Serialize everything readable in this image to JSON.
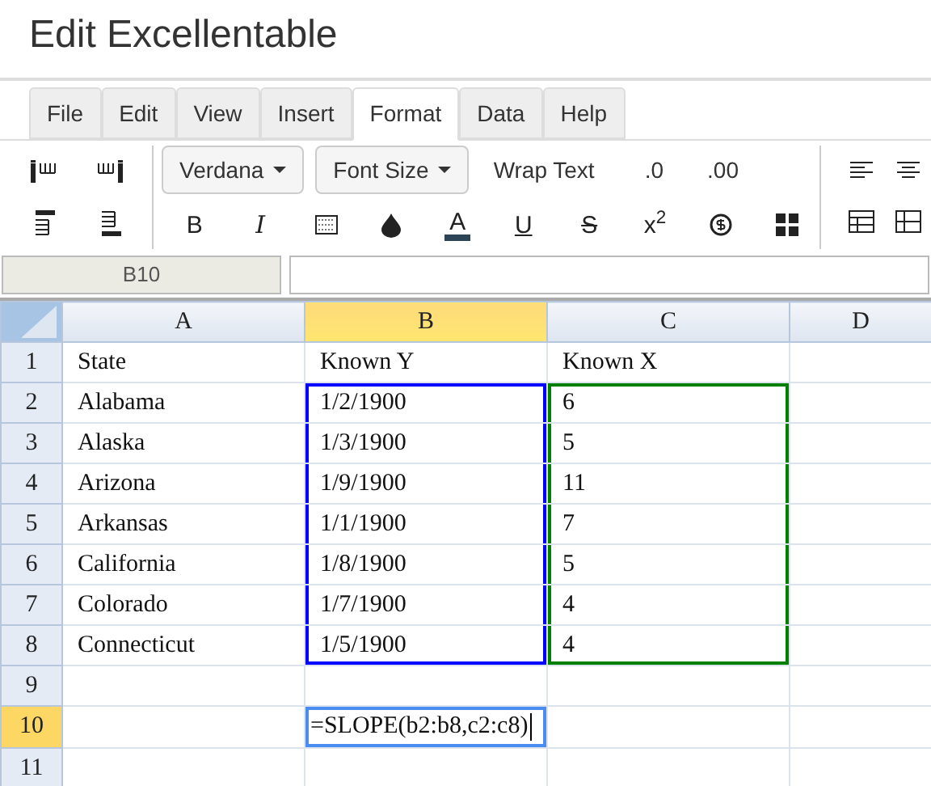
{
  "window": {
    "title": "Edit Excellentable"
  },
  "menu_tabs": [
    {
      "label": "File",
      "selected": false
    },
    {
      "label": "Edit",
      "selected": false
    },
    {
      "label": "View",
      "selected": false
    },
    {
      "label": "Insert",
      "selected": false
    },
    {
      "label": "Format",
      "selected": true
    },
    {
      "label": "Data",
      "selected": false
    },
    {
      "label": "Help",
      "selected": false
    }
  ],
  "toolbar": {
    "font_dropdown": "Verdana",
    "size_dropdown": "Font Size",
    "text_buttons": [
      "Wrap Text",
      ".0",
      ".00"
    ],
    "format_buttons": [
      {
        "kind": "bold",
        "label": "B"
      },
      {
        "kind": "italic",
        "label": "I"
      },
      {
        "kind": "border"
      },
      {
        "kind": "fill"
      },
      {
        "kind": "color",
        "label": "A"
      },
      {
        "kind": "underline",
        "label": "U"
      },
      {
        "kind": "strike",
        "label": "S"
      },
      {
        "kind": "super",
        "label": "x$^{2}$"
      },
      {
        "kind": "currency"
      },
      {
        "kind": "grid"
      }
    ]
  },
  "name_box": "B10",
  "grid": {
    "columns": [
      {
        "label": "A",
        "selected": false
      },
      {
        "label": "B",
        "selected": true
      },
      {
        "label": "C",
        "selected": false
      },
      {
        "label": "D",
        "selected": false
      }
    ],
    "rows": [
      {
        "label": "1",
        "selected": false,
        "cells": [
          {
            "text": "State"
          },
          {
            "text": "Known Y"
          },
          {
            "text": "Known X"
          },
          {}
        ]
      },
      {
        "label": "2",
        "selected": false,
        "cells": [
          {
            "text": "Alabama"
          },
          {
            "text": "1/2/1900",
            "color": "#0000ff"
          },
          {
            "text": "6",
            "color": "#008000"
          },
          {}
        ]
      },
      {
        "label": "3",
        "selected": false,
        "cells": [
          {
            "text": "Alaska"
          },
          {
            "text": "1/3/1900",
            "color": "#0000ff"
          },
          {
            "text": "5",
            "color": "#008000"
          },
          {}
        ]
      },
      {
        "label": "4",
        "selected": false,
        "cells": [
          {
            "text": "Arizona"
          },
          {
            "text": "1/9/1900",
            "color": "#0000ff"
          },
          {
            "text": "11",
            "color": "#008000"
          },
          {}
        ]
      },
      {
        "label": "5",
        "selected": false,
        "cells": [
          {
            "text": "Arkansas"
          },
          {
            "text": "1/1/1900",
            "color": "#0000ff"
          },
          {
            "text": "7",
            "color": "#008000"
          },
          {}
        ]
      },
      {
        "label": "6",
        "selected": false,
        "cells": [
          {
            "text": "California"
          },
          {
            "text": "1/8/1900",
            "color": "#0000ff"
          },
          {
            "text": "5",
            "color": "#008000"
          },
          {}
        ]
      },
      {
        "label": "7",
        "selected": false,
        "cells": [
          {
            "text": "Colorado"
          },
          {
            "text": "1/7/1900",
            "color": "#0000ff"
          },
          {
            "text": "4",
            "color": "#008000"
          },
          {}
        ]
      },
      {
        "label": "8",
        "selected": false,
        "cells": [
          {
            "text": "Connecticut"
          },
          {
            "text": "1/5/1900",
            "color": "#0000ff"
          },
          {
            "text": "4",
            "color": "#008000"
          },
          {}
        ]
      },
      {
        "label": "9",
        "selected": false,
        "cells": [
          {},
          {},
          {},
          {}
        ]
      },
      {
        "label": "10",
        "selected": true,
        "cells": [
          {},
          {
            "text": "=SLOPE(b2:b8,c2:c8)",
            "editing": true
          },
          {},
          {}
        ]
      },
      {
        "label": "11",
        "selected": false,
        "cells": [
          {},
          {},
          {},
          {}
        ]
      }
    ]
  }
}
